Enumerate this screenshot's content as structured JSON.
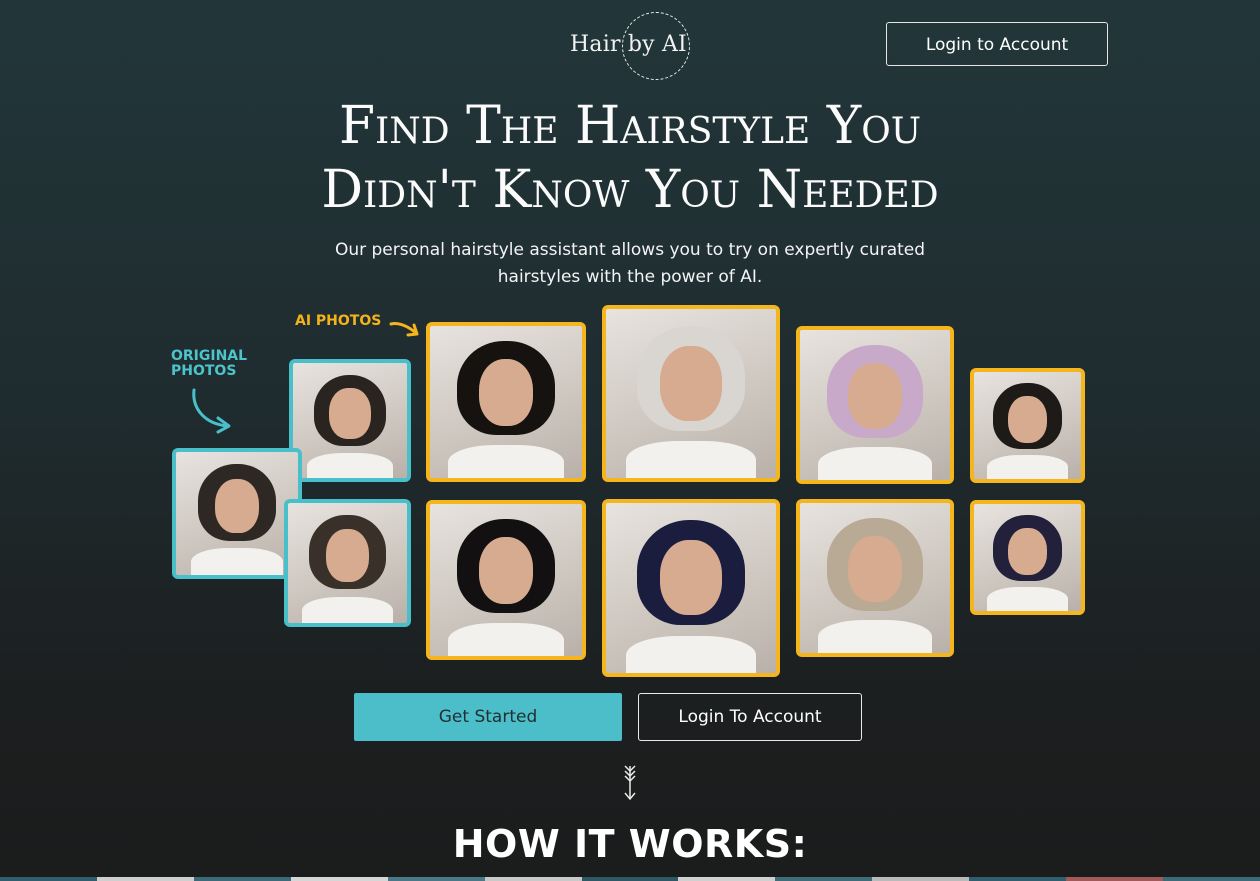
{
  "header": {
    "logo_text": "Hair by AI",
    "login_label": "Login to Account"
  },
  "hero": {
    "headline_line1": "Find The Hairstyle You",
    "headline_line2": "Didn't Know You Needed",
    "subtitle": "Our personal hairstyle assistant allows you to try on expertly curated hairstyles with the power of AI."
  },
  "showcase": {
    "original_label": "ORIGINAL PHOTOS",
    "ai_label": "AI PHOTOS",
    "colors": {
      "original_border": "#49bfc9",
      "ai_border": "#f5b51c"
    },
    "original_photos": [
      {
        "hair": "#2a2420"
      },
      {
        "hair": "#2e2824"
      },
      {
        "hair": "#3a302a"
      }
    ],
    "ai_photos": [
      {
        "hair": "#151210"
      },
      {
        "hair": "#d9d6d2"
      },
      {
        "hair": "#c9a9c9"
      },
      {
        "hair": "#1d1a18"
      },
      {
        "hair": "#121011"
      },
      {
        "hair": "#1a1d3e"
      },
      {
        "hair": "#b9aa96"
      },
      {
        "hair": "#22203a"
      }
    ]
  },
  "cta": {
    "get_started_label": "Get Started",
    "login_label": "Login To Account"
  },
  "section": {
    "how_it_works": "HOW IT WORKS:"
  },
  "theme": {
    "accent": "#4bbec9",
    "highlight": "#f5b51c"
  }
}
